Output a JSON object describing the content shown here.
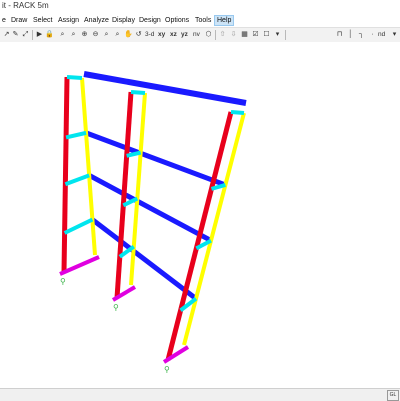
{
  "window": {
    "title": "it - RACK 5m"
  },
  "menu": {
    "items": [
      {
        "label": "e"
      },
      {
        "label": "Draw"
      },
      {
        "label": "Select"
      },
      {
        "label": "Assign"
      },
      {
        "label": "Analyze"
      },
      {
        "label": "Display"
      },
      {
        "label": "Design"
      },
      {
        "label": "Options"
      },
      {
        "label": "Tools"
      },
      {
        "label": "Help",
        "active": true
      }
    ]
  },
  "toolbar": {
    "view_3d": "3-d",
    "view_xy": "xy",
    "view_xz": "xz",
    "view_yz": "yz",
    "view_nv": "nv",
    "units": "nd"
  },
  "status": {
    "box_text": "GL"
  },
  "colors": {
    "columns": "#e8001c",
    "braces": "#ffff00",
    "beams": "#1a1aff",
    "joints": "#00e5ee",
    "supports": "#e000e0",
    "restraints": "#3cb34a"
  }
}
